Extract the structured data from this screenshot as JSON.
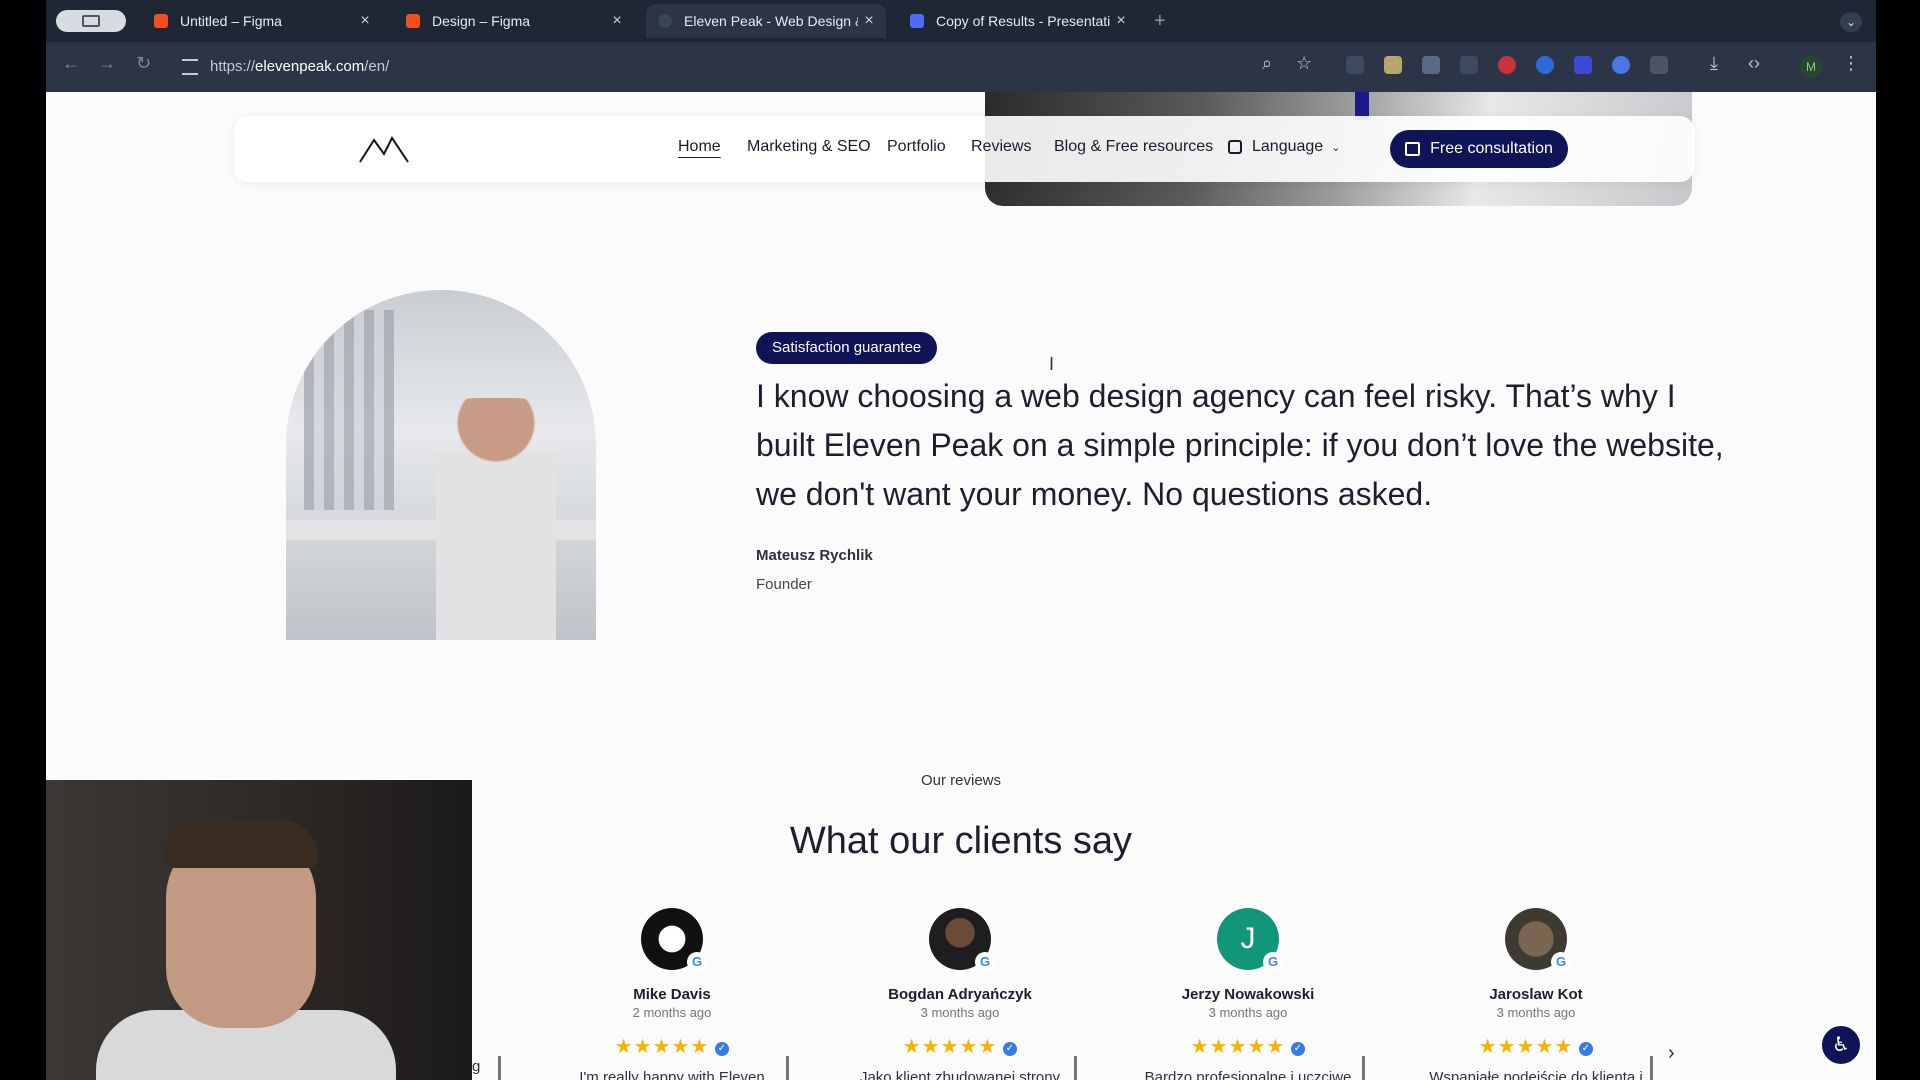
{
  "browser": {
    "tabs": [
      {
        "title": "Untitled – Figma",
        "color": "#f24e1e"
      },
      {
        "title": "Design – Figma",
        "color": "#f24e1e"
      },
      {
        "title": "Eleven Peak - Web Design & I",
        "color": "#2b3547"
      },
      {
        "title": "Copy of Results - Presentatio",
        "color": "#4a6cf7"
      }
    ],
    "url_prefix": "https://",
    "url_host": "elevenpeak.com",
    "url_path": "/en/",
    "profile_initial": "M"
  },
  "nav": {
    "items": [
      "Home",
      "Marketing & SEO",
      "Portfolio",
      "Reviews",
      "Blog & Free resources"
    ],
    "language": "Language",
    "cta": "Free consultation"
  },
  "guarantee": {
    "badge": "Satisfaction guarantee",
    "quote": "I know choosing a web design agency can feel risky. That’s why I built Eleven Peak on a simple principle: if you don’t love the website, we don't want your money. No questions asked.",
    "name": "Mateusz Rychlik",
    "role": "Founder"
  },
  "reviews": {
    "label": "Our reviews",
    "title": "What our clients say",
    "items": [
      {
        "name": "Mike Davis",
        "time": "2 months ago",
        "text": "I'm really happy with Eleven",
        "stars": 5
      },
      {
        "name": "Bogdan Adryańczyk",
        "time": "3 months ago",
        "text": "Jako klient zbudowanej strony",
        "stars": 5
      },
      {
        "name": "Jerzy Nowakowski",
        "time": "3 months ago",
        "text": "Bardzo profesjonalne i uczciwe",
        "stars": 5
      },
      {
        "name": "Jaroslaw Kot",
        "time": "3 months ago",
        "text": "Wspaniałe podejście do klienta i",
        "stars": 5
      }
    ],
    "partial_text": "g",
    "avatar_letter": "J"
  },
  "colors": {
    "brand_navy": "#0f1456",
    "star": "#f5b400"
  }
}
